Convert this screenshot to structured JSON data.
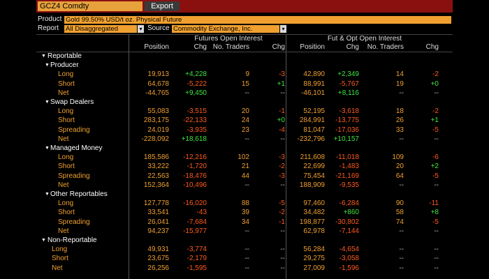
{
  "window": {
    "ticker": "GCZ4 Comdty",
    "export_label": "Export"
  },
  "controls": {
    "product_label": "Product",
    "product_value": "Gold 99.50% USD/t oz. Physical Future",
    "report_label": "Report",
    "report_value": "All Disaggregated",
    "source_label": "Source",
    "source_value": "Commodity Exchange, Inc."
  },
  "headers": {
    "futures_group": "Futures Open Interest",
    "futopt_group": "Fut & Opt Open Interest",
    "position": "Position",
    "chg": "Chg",
    "traders": "No. Traders",
    "chg2": "Chg"
  },
  "colors": {
    "accent_orange": "#f0a030",
    "negative": "#ff5a1f",
    "positive": "#3fe63f",
    "title_bar": "#8a1010"
  },
  "rows": [
    {
      "type": "group",
      "label": "Reportable"
    },
    {
      "type": "subgroup",
      "label": "Producer"
    },
    {
      "type": "data",
      "label": "Long",
      "c": [
        "19,913",
        "+4,228",
        "9",
        "-3",
        "42,890",
        "+2,349",
        "14",
        "-2"
      ]
    },
    {
      "type": "data",
      "label": "Short",
      "c": [
        "64,678",
        "-5,222",
        "15",
        "+1",
        "88,991",
        "-5,767",
        "19",
        "+0"
      ]
    },
    {
      "type": "data",
      "label": "Net",
      "c": [
        "-44,765",
        "+9,450",
        "--",
        "--",
        "-46,101",
        "+8,116",
        "--",
        "--"
      ]
    },
    {
      "type": "subgroup",
      "label": "Swap Dealers"
    },
    {
      "type": "data",
      "label": "Long",
      "c": [
        "55,083",
        "-3,515",
        "20",
        "-1",
        "52,195",
        "-3,618",
        "18",
        "-2"
      ]
    },
    {
      "type": "data",
      "label": "Short",
      "c": [
        "283,175",
        "-22,133",
        "24",
        "+0",
        "284,991",
        "-13,775",
        "26",
        "+1"
      ]
    },
    {
      "type": "data",
      "label": "Spreading",
      "c": [
        "24,019",
        "-3,935",
        "23",
        "-4",
        "81,047",
        "-17,036",
        "33",
        "-5"
      ]
    },
    {
      "type": "data",
      "label": "Net",
      "c": [
        "-228,092",
        "+18,618",
        "--",
        "--",
        "-232,796",
        "+10,157",
        "--",
        "--"
      ]
    },
    {
      "type": "subgroup",
      "label": "Managed Money"
    },
    {
      "type": "data",
      "label": "Long",
      "c": [
        "185,586",
        "-12,216",
        "102",
        "-3",
        "211,608",
        "-11,018",
        "109",
        "-6"
      ]
    },
    {
      "type": "data",
      "label": "Short",
      "c": [
        "33,222",
        "-1,720",
        "21",
        "-2",
        "22,699",
        "-1,483",
        "20",
        "+2"
      ]
    },
    {
      "type": "data",
      "label": "Spreading",
      "c": [
        "22,563",
        "-18,476",
        "44",
        "-3",
        "75,454",
        "-21,169",
        "64",
        "-5"
      ]
    },
    {
      "type": "data",
      "label": "Net",
      "c": [
        "152,364",
        "-10,496",
        "--",
        "--",
        "188,909",
        "-9,535",
        "--",
        "--"
      ]
    },
    {
      "type": "subgroup",
      "label": "Other Reportables"
    },
    {
      "type": "data",
      "label": "Long",
      "c": [
        "127,778",
        "-16,020",
        "88",
        "-5",
        "97,460",
        "-6,284",
        "90",
        "-11"
      ]
    },
    {
      "type": "data",
      "label": "Short",
      "c": [
        "33,541",
        "-43",
        "39",
        "-2",
        "34,482",
        "+860",
        "58",
        "+8"
      ]
    },
    {
      "type": "data",
      "label": "Spreading",
      "c": [
        "26,041",
        "-7,684",
        "34",
        "-1",
        "198,877",
        "-30,802",
        "74",
        "-5"
      ]
    },
    {
      "type": "data",
      "label": "Net",
      "c": [
        "94,237",
        "-15,977",
        "--",
        "--",
        "62,978",
        "-7,144",
        "--",
        "--"
      ]
    },
    {
      "type": "group",
      "label": "Non-Reportable"
    },
    {
      "type": "data2",
      "label": "Long",
      "c": [
        "49,931",
        "-3,774",
        "--",
        "--",
        "56,284",
        "-4,654",
        "--",
        "--"
      ]
    },
    {
      "type": "data2",
      "label": "Short",
      "c": [
        "23,675",
        "-2,179",
        "--",
        "--",
        "29,275",
        "-3,058",
        "--",
        "--"
      ]
    },
    {
      "type": "data2",
      "label": "Net",
      "c": [
        "26,256",
        "-1,595",
        "--",
        "--",
        "27,009",
        "-1,596",
        "--",
        "--"
      ]
    }
  ]
}
